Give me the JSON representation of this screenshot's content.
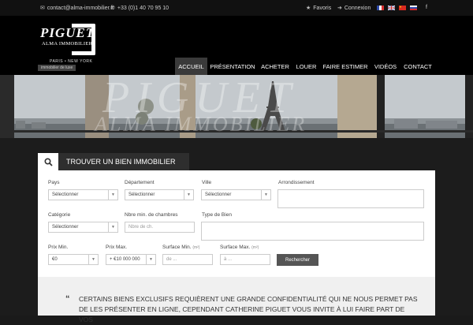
{
  "topbar": {
    "email": "contact@alma-immobilier.fr",
    "phone": "+33 (0)1 40 70 95 10",
    "favorites": "Favoris",
    "login": "Connexion",
    "social": "f"
  },
  "brand": {
    "name": "PIGUET",
    "sub": "ALMA IMMOBILIER",
    "cities": "PARIS • NEW YORK",
    "tagline": "immobilier de luxe"
  },
  "nav": {
    "items": [
      "ACCUEIL",
      "PRÉSENTATION",
      "ACHETER",
      "LOUER",
      "FAIRE ESTIMER",
      "VIDÉOS",
      "CONTACT"
    ],
    "active_index": 0
  },
  "search": {
    "title": "TROUVER UN BIEN IMMOBILIER",
    "country_label": "Pays",
    "department_label": "Département",
    "city_label": "Ville",
    "district_label": "Arrondissement",
    "select_default": "Sélectionner",
    "category_label": "Catégorie",
    "rooms_label": "Nbre min. de chambres",
    "rooms_placeholder": "Nbre de ch.",
    "type_label": "Type de Bien",
    "price_min_label": "Prix Min.",
    "price_max_label": "Prix Max.",
    "price_min_value": "€0",
    "price_max_value": "+ €10 000 000",
    "surface_min_label": "Surface Min.",
    "surface_max_label": "Surface Max.",
    "unit": "(m²)",
    "surface_min_placeholder": "de ...",
    "surface_max_placeholder": "à ...",
    "submit": "Rechercher"
  },
  "quote": {
    "mark": "“",
    "text": "CERTAINS BIENS EXCLUSIFS REQUIÈRENT UNE GRANDE CONFIDENTIALITÉ QUI NE NOUS PERMET PAS DE LES PRÉSENTER EN LIGNE, CEPENDANT CATHERINE PIGUET VOUS INVITE À LUI FAIRE PART DE VOS"
  },
  "colors": {
    "background": "#1a1a1a",
    "header": "#000000",
    "nav_active": "#3a3a3a",
    "button": "#555555"
  }
}
